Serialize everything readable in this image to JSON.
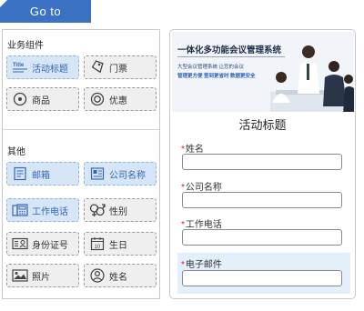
{
  "nav": {
    "goto_label": "Go  to"
  },
  "palette": {
    "group_business": "业务组件",
    "group_other": "其他",
    "business_items": [
      {
        "label": "活动标题",
        "icon": "title-icon",
        "active": true
      },
      {
        "label": "门票",
        "icon": "ticket-icon",
        "active": false
      },
      {
        "label": "商品",
        "icon": "product-icon",
        "active": false
      },
      {
        "label": "优惠",
        "icon": "discount-icon",
        "active": false
      }
    ],
    "other_items": [
      {
        "label": "邮箱",
        "icon": "email-icon",
        "active": true
      },
      {
        "label": "公司名称",
        "icon": "company-icon",
        "active": true
      },
      {
        "label": "工作电话",
        "icon": "phone-icon",
        "active": true
      },
      {
        "label": "性别",
        "icon": "gender-icon",
        "active": false
      },
      {
        "label": "身份证号",
        "icon": "id-card-icon",
        "active": false
      },
      {
        "label": "生日",
        "icon": "birthday-icon",
        "active": false
      },
      {
        "label": "照片",
        "icon": "photo-icon",
        "active": false
      },
      {
        "label": "姓名",
        "icon": "user-icon",
        "active": false
      }
    ]
  },
  "preview": {
    "banner": {
      "title": "一体化多功能会议管理系统",
      "subtitle": "大型会议管理系统 让您的会议",
      "tagline": "管理更方便  签到更省时  数据更安全"
    },
    "form_title": "活动标题",
    "required_mark": "*",
    "fields": [
      {
        "label": "姓名",
        "highlighted": false
      },
      {
        "label": "公司名称",
        "highlighted": false
      },
      {
        "label": "工作电话",
        "highlighted": false
      },
      {
        "label": "电子邮件",
        "highlighted": true
      }
    ]
  },
  "colors": {
    "accent": "#3b72c4",
    "active_item_bg": "#d7e6f7",
    "active_item_text": "#3567b3",
    "required": "#e02020",
    "highlight_field_bg": "#e3effb"
  }
}
